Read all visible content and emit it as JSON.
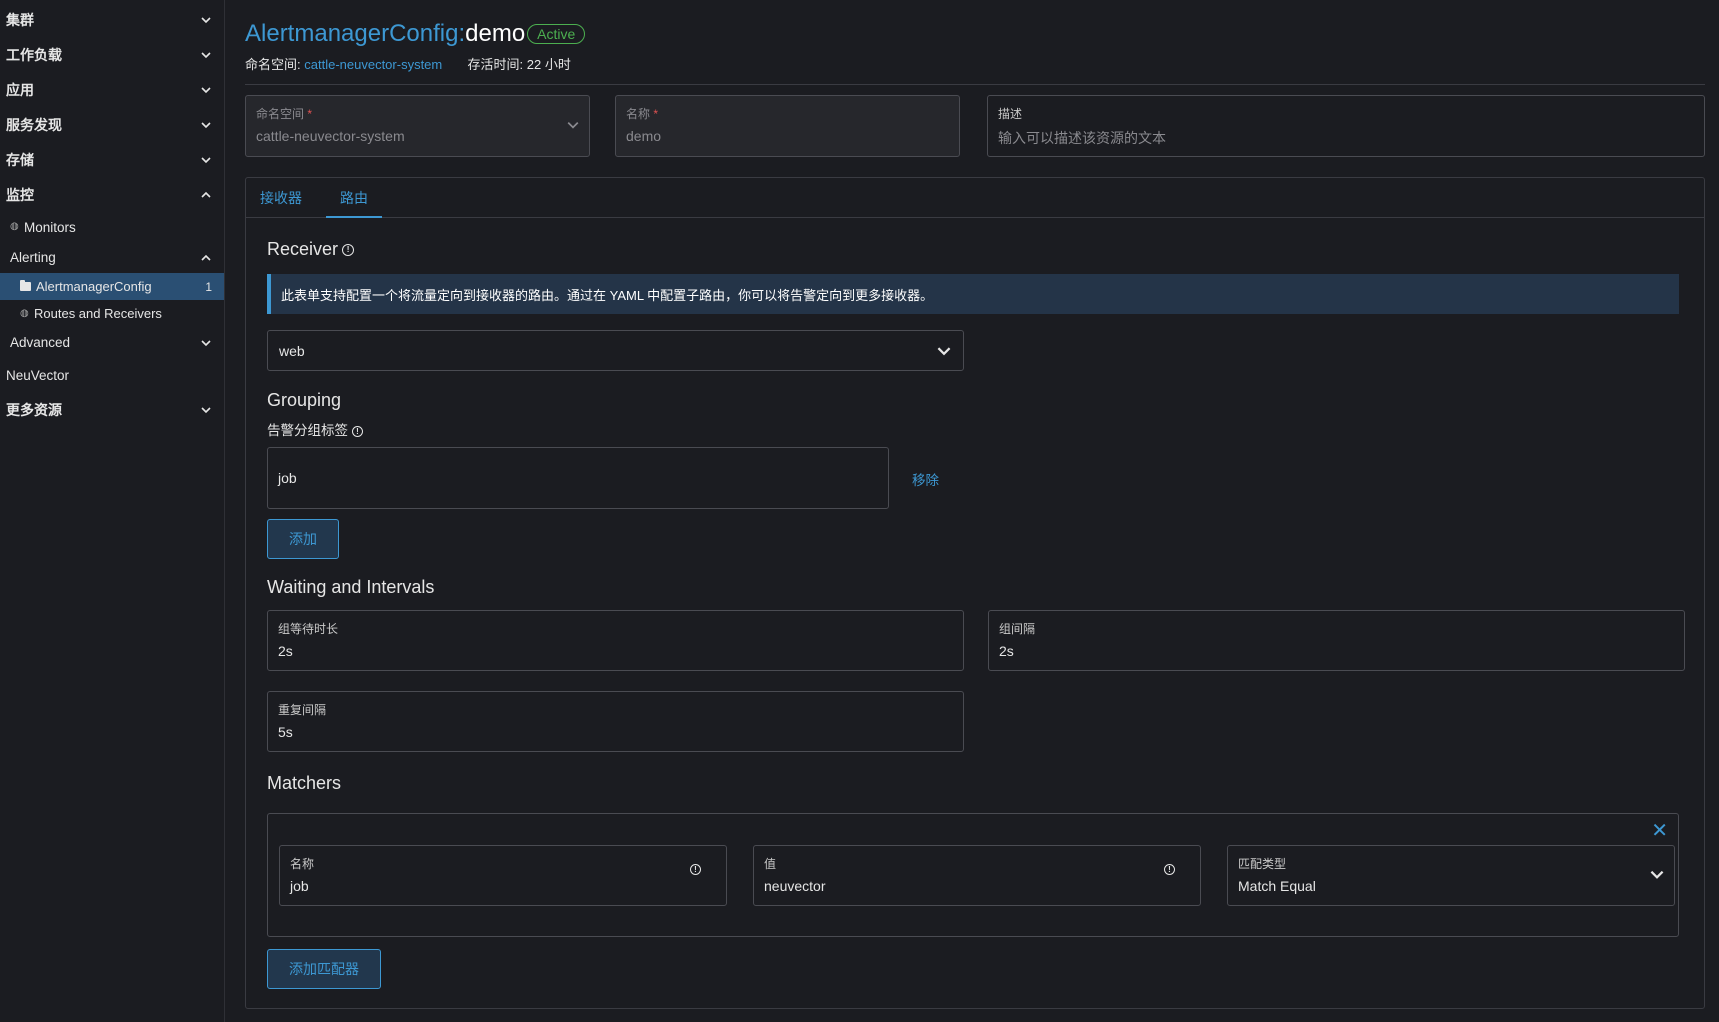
{
  "sidebar": {
    "groups": [
      {
        "label": "集群"
      },
      {
        "label": "工作负载"
      },
      {
        "label": "应用"
      },
      {
        "label": "服务发现"
      },
      {
        "label": "存储"
      },
      {
        "label": "监控"
      }
    ],
    "monitors": "Monitors",
    "alerting": "Alerting",
    "alertmanager_config": "AlertmanagerConfig",
    "alertmanager_count": "1",
    "routes_receivers": "Routes and Receivers",
    "advanced": "Advanced",
    "neuvector": "NeuVector",
    "more_resources": "更多资源"
  },
  "header": {
    "resource_type": "AlertmanagerConfig:",
    "resource_name": "demo",
    "status": "Active",
    "namespace_label": "命名空间:",
    "namespace_value": "cattle-neuvector-system",
    "age_label": "存活时间:",
    "age_value": "22 小时"
  },
  "fields": {
    "namespace_label": "命名空间",
    "namespace_value": "cattle-neuvector-system",
    "name_label": "名称",
    "name_value": "demo",
    "desc_label": "描述",
    "desc_placeholder": "输入可以描述该资源的文本"
  },
  "tabs": [
    {
      "label": "接收器"
    },
    {
      "label": "路由"
    }
  ],
  "receiver": {
    "heading": "Receiver",
    "banner": "此表单支持配置一个将流量定向到接收器的路由。通过在 YAML 中配置子路由，你可以将告警定向到更多接收器。",
    "selected": "web"
  },
  "grouping": {
    "heading": "Grouping",
    "label": "告警分组标签",
    "value": "job",
    "remove": "移除",
    "add": "添加"
  },
  "waiting": {
    "heading": "Waiting and Intervals",
    "group_wait_label": "组等待时长",
    "group_wait_value": "2s",
    "group_interval_label": "组间隔",
    "group_interval_value": "2s",
    "repeat_label": "重复间隔",
    "repeat_value": "5s"
  },
  "matchers": {
    "heading": "Matchers",
    "name_label": "名称",
    "name_value": "job",
    "value_label": "值",
    "value_value": "neuvector",
    "type_label": "匹配类型",
    "type_value": "Match Equal",
    "add": "添加匹配器"
  },
  "colors": {
    "accent": "#3d98d3",
    "active": "#4caf50",
    "background": "#1b1c21"
  }
}
